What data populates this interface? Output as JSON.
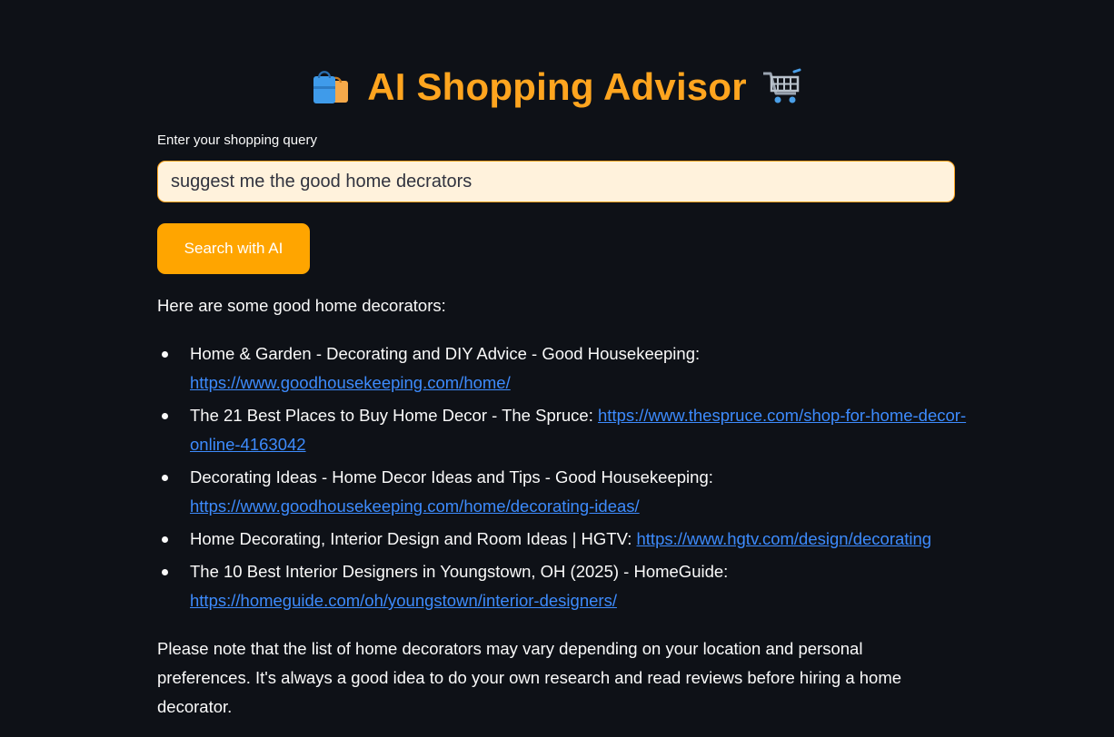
{
  "header": {
    "title": "AI Shopping Advisor",
    "left_icon": "shopping-bags-icon",
    "right_icon": "shopping-cart-icon"
  },
  "query": {
    "label": "Enter your shopping query",
    "value": "suggest me the good home decrators"
  },
  "search_button": {
    "label": "Search with AI"
  },
  "response": {
    "intro": "Here are some good home decorators:",
    "items": [
      {
        "text": "Home & Garden - Decorating and DIY Advice - Good Housekeeping:",
        "link": "https://www.goodhousekeeping.com/home/"
      },
      {
        "text": "The 21 Best Places to Buy Home Decor - The Spruce:",
        "link": "https://www.thespruce.com/shop-for-home-decor-online-4163042"
      },
      {
        "text": "Decorating Ideas - Home Decor Ideas and Tips - Good Housekeeping:",
        "link": "https://www.goodhousekeeping.com/home/decorating-ideas/"
      },
      {
        "text": "Home Decorating, Interior Design and Room Ideas | HGTV:",
        "link": "https://www.hgtv.com/design/decorating"
      },
      {
        "text": "The 10 Best Interior Designers in Youngstown, OH (2025) - HomeGuide:",
        "link": "https://homeguide.com/oh/youngstown/interior-designers/"
      }
    ],
    "note": "Please note that the list of home decorators may vary depending on your location and personal preferences. It's always a good idea to do your own research and read reviews before hiring a home decorator."
  },
  "colors": {
    "background": "#0e1117",
    "accent": "#ffa51f",
    "link": "#3d8bfd",
    "input_bg": "#fff2dc"
  }
}
